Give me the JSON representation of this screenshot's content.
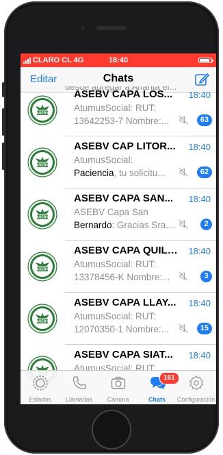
{
  "status_bar": {
    "carrier": "CLARO CL 4G",
    "time": "18:40",
    "battery_level": 0.9
  },
  "nav": {
    "edit_label": "Editar",
    "title": "Chats",
    "compose_icon": "compose-icon"
  },
  "partial_preview": "desde agregar a Ahanta el...",
  "chats": [
    {
      "name": "ASEBV CAPA LOS...",
      "time": "18:40",
      "preview_1": "AtumusSocial: RUT:",
      "preview_1_bold": "",
      "preview_2": "13642253-7 Nombre:...",
      "preview_2_bold": "",
      "unread": "63"
    },
    {
      "name": "ASEBV CAP LITOR...",
      "time": "18:40",
      "preview_1": "AtumusSocial:",
      "preview_1_bold": "",
      "preview_2": ", tu solicitu...",
      "preview_2_bold": "Paciencia",
      "unread": "62"
    },
    {
      "name": "ASEBV CAPA SAN...",
      "time": "18:40",
      "preview_1": "ASEBV Capa San",
      "preview_1_bold": "",
      "preview_2": ": Gracias Sra....",
      "preview_2_bold": "Bernardo",
      "unread": "2"
    },
    {
      "name": "ASEBV CAPA QUILI...",
      "time": "18:40",
      "preview_1": "AtumusSocial: RUT:",
      "preview_1_bold": "",
      "preview_2": "13378456-K Nombre:...",
      "preview_2_bold": "",
      "unread": "3"
    },
    {
      "name": "ASEBV CAPA LLAY...",
      "time": "18:40",
      "preview_1": "AtumusSocial: RUT:",
      "preview_1_bold": "",
      "preview_2": "12070350-1 Nombre:...",
      "preview_2_bold": "",
      "unread": "15"
    },
    {
      "name": "ASEBV CAPA SIAT...",
      "time": "18:40",
      "preview_1": "AtumusSocial: RUT:",
      "preview_1_bold": "",
      "preview_2": "",
      "preview_2_bold": "",
      "unread": ""
    }
  ],
  "avatar_label": "ASEBV",
  "tabs": [
    {
      "label": "Estados",
      "icon": "status-icon"
    },
    {
      "label": "Llamadas",
      "icon": "phone-icon"
    },
    {
      "label": "Cámara",
      "icon": "camera-icon"
    },
    {
      "label": "Chats",
      "icon": "chats-icon",
      "badge": "161"
    },
    {
      "label": "Configuración",
      "icon": "settings-icon"
    }
  ],
  "colors": {
    "accent": "#1e7cf6",
    "status_bar": "#ff3b30",
    "badge": "#ff3b30",
    "muted_text": "#8e8e93",
    "avatar_green": "#2f7d3a"
  }
}
